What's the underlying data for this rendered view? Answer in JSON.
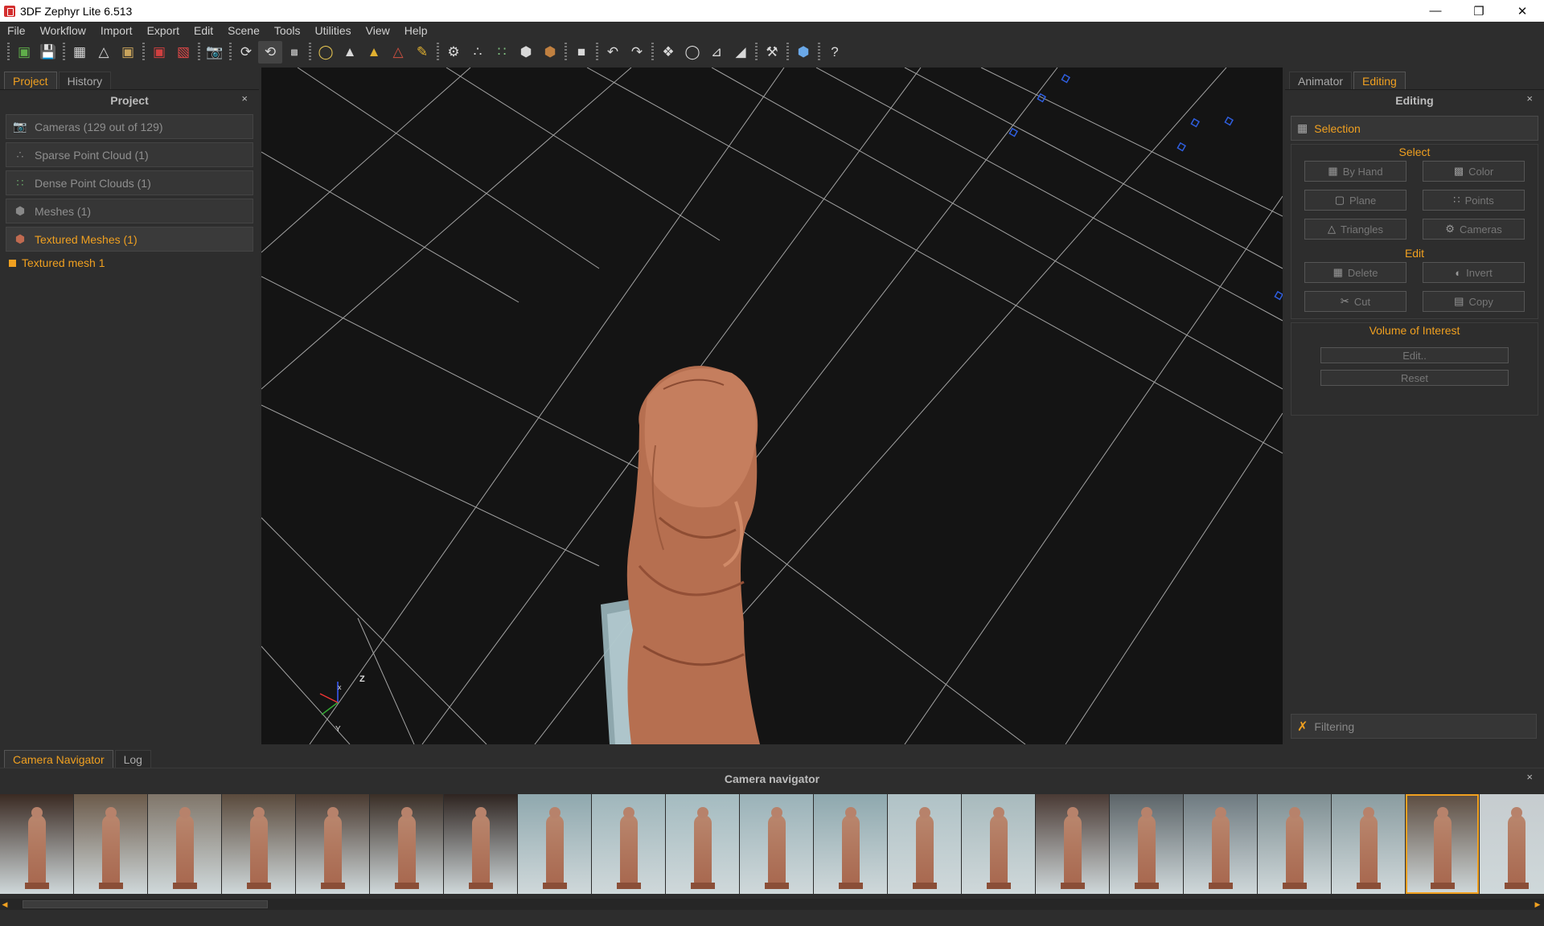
{
  "title": "3DF Zephyr Lite 6.513",
  "menu": [
    "File",
    "Workflow",
    "Import",
    "Export",
    "Edit",
    "Scene",
    "Tools",
    "Utilities",
    "View",
    "Help"
  ],
  "left_tabs": [
    "Project",
    "History"
  ],
  "project": {
    "header": "Project",
    "close": "×",
    "items": [
      {
        "label": "Cameras (129 out of 129)",
        "icon": "camera-icon"
      },
      {
        "label": "Sparse Point Cloud (1)",
        "icon": "sparse-cloud-icon"
      },
      {
        "label": "Dense Point Clouds (1)",
        "icon": "dense-cloud-icon"
      },
      {
        "label": "Meshes (1)",
        "icon": "mesh-icon"
      },
      {
        "label": "Textured Meshes (1)",
        "icon": "textured-mesh-icon"
      }
    ],
    "subitem": "Textured mesh 1"
  },
  "right_tabs": [
    "Animator",
    "Editing"
  ],
  "editing": {
    "header": "Editing",
    "close": "×",
    "selection_label": "Selection",
    "select_title": "Select",
    "select_buttons": [
      "By Hand",
      "Color",
      "Plane",
      "Points",
      "Triangles",
      "Cameras"
    ],
    "edit_title": "Edit",
    "edit_buttons": [
      "Delete",
      "Invert",
      "Cut",
      "Copy"
    ],
    "voi_title": "Volume of Interest",
    "voi_buttons": [
      "Edit..",
      "Reset"
    ],
    "filtering_label": "Filtering"
  },
  "axes": {
    "z": "Z",
    "x": "x",
    "y": "Y"
  },
  "bottom_tabs": [
    "Camera Navigator",
    "Log"
  ],
  "navigator": {
    "header": "Camera navigator",
    "close": "×",
    "selected_index": 19
  },
  "colors": {
    "accent": "#f0a020",
    "viewport": "#141414",
    "panel": "#2d2d2d"
  }
}
